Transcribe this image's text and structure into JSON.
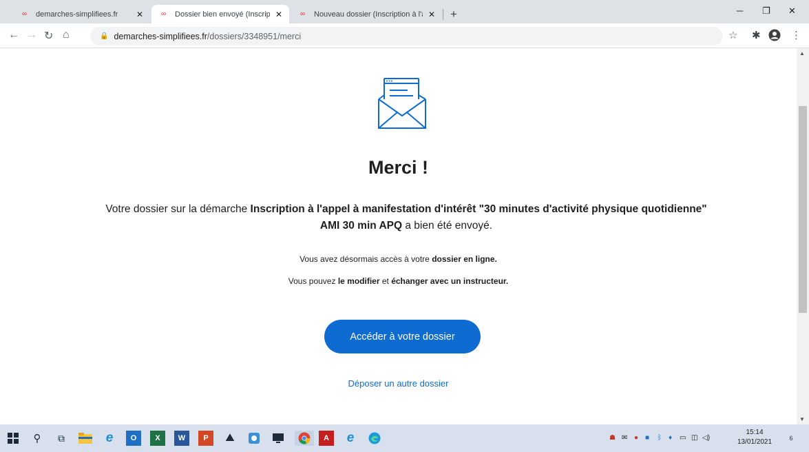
{
  "browser": {
    "tabs": [
      {
        "title": "demarches-simplifiees.fr",
        "active": false
      },
      {
        "title": "Dossier bien envoyé (Inscription",
        "active": true
      },
      {
        "title": "Nouveau dossier (Inscription à l'a",
        "active": false
      }
    ],
    "tab_icon": "infinity-icon",
    "new_tab": "+",
    "url_domain": "demarches-simplifiees.fr",
    "url_path": "/dossiers/3348951/merci"
  },
  "page": {
    "title": "Merci !",
    "message_prefix": "Votre dossier sur la démarche ",
    "procedure_name": "Inscription à l'appel à manifestation d'intérêt \"30 minutes d'activité physique quotidienne\" AMI 30 min APQ",
    "message_suffix": " a bien été envoyé.",
    "access_text": "Vous avez désormais accès à votre ",
    "access_bold": "dossier en ligne.",
    "edit_prefix": "Vous pouvez ",
    "edit_bold_1": "le modifier",
    "edit_middle": " et ",
    "edit_bold_2": "échanger avec un instructeur.",
    "primary_button": "Accéder à votre dossier",
    "secondary_link": "Déposer un autre dossier"
  },
  "taskbar": {
    "time": "15:14",
    "date": "13/01/2021",
    "notification_count": "6"
  },
  "colors": {
    "accent": "#0d6bd1",
    "text": "#1e1e1e",
    "tab_bar": "#dee1e6",
    "taskbar": "#d7e0ec"
  }
}
